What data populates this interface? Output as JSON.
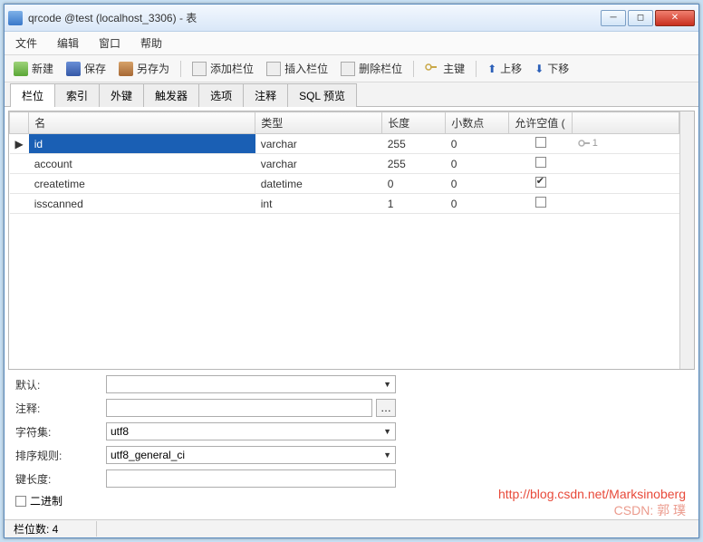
{
  "window": {
    "title": "qrcode @test (localhost_3306) - 表"
  },
  "menu": {
    "file": "文件",
    "edit": "编辑",
    "window": "窗口",
    "help": "帮助"
  },
  "toolbar": {
    "new": "新建",
    "save": "保存",
    "saveas": "另存为",
    "addcol": "添加栏位",
    "insertcol": "插入栏位",
    "delcol": "删除栏位",
    "pkey": "主键",
    "moveup": "上移",
    "movedown": "下移"
  },
  "tabs": {
    "fields": "栏位",
    "index": "索引",
    "fk": "外键",
    "trigger": "触发器",
    "option": "选项",
    "comment": "注释",
    "sql": "SQL 预览"
  },
  "gridHeaders": {
    "name": "名",
    "type": "类型",
    "len": "长度",
    "dec": "小数点",
    "null": "允许空值 (",
    "key": ""
  },
  "rows": [
    {
      "name": "id",
      "type": "varchar",
      "len": "255",
      "dec": "0",
      "null": false,
      "key": "1",
      "selected": true
    },
    {
      "name": "account",
      "type": "varchar",
      "len": "255",
      "dec": "0",
      "null": false,
      "key": "",
      "selected": false
    },
    {
      "name": "createtime",
      "type": "datetime",
      "len": "0",
      "dec": "0",
      "null": true,
      "key": "",
      "selected": false
    },
    {
      "name": "isscanned",
      "type": "int",
      "len": "1",
      "dec": "0",
      "null": false,
      "key": "",
      "selected": false
    }
  ],
  "props": {
    "defaultLabel": "默认:",
    "defaultValue": "",
    "commentLabel": "注释:",
    "commentValue": "",
    "charsetLabel": "字符集:",
    "charsetValue": "utf8",
    "collateLabel": "排序规则:",
    "collateValue": "utf8_general_ci",
    "keylenLabel": "键长度:",
    "keylenValue": "",
    "binaryLabel": "二进制"
  },
  "status": {
    "text": "栏位数: 4"
  },
  "watermark": {
    "url": "http://blog.csdn.net/Marksinoberg",
    "author": "CSDN: 郭 璞"
  }
}
